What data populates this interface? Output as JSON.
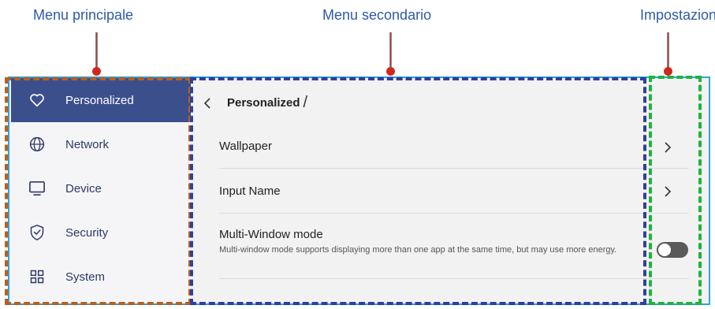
{
  "callouts": {
    "main_menu": "Menu principale",
    "sub_menu": "Menu secondario",
    "settings": "Impostazioni"
  },
  "colors": {
    "callout_text": "#2d5aa8",
    "main_menu_box": "#b8601b",
    "sub_menu_box": "#2f3ea0",
    "settings_box": "#1fb33b",
    "screen_border": "#2fa3e0",
    "active_item": "#3c4f8d",
    "marker_dot": "#d0281e"
  },
  "sidebar": {
    "items": [
      {
        "label": "Personalized",
        "icon": "heart-icon",
        "active": true
      },
      {
        "label": "Network",
        "icon": "globe-icon",
        "active": false
      },
      {
        "label": "Device",
        "icon": "monitor-icon",
        "active": false
      },
      {
        "label": "Security",
        "icon": "shield-check-icon",
        "active": false
      },
      {
        "label": "System",
        "icon": "grid-icon",
        "active": false
      }
    ]
  },
  "submenu": {
    "breadcrumb": "Personalized",
    "breadcrumb_separator": "/",
    "back_icon": "chevron-left-icon",
    "rows": [
      {
        "label": "Wallpaper",
        "control": "chevron-right-icon"
      },
      {
        "label": "Input Name",
        "control": "chevron-right-icon"
      },
      {
        "label": "Multi-Window mode",
        "description": "Multi-window mode supports displaying more than one app at the same time, but may use more energy.",
        "control": "toggle",
        "toggle_on": false
      }
    ]
  }
}
